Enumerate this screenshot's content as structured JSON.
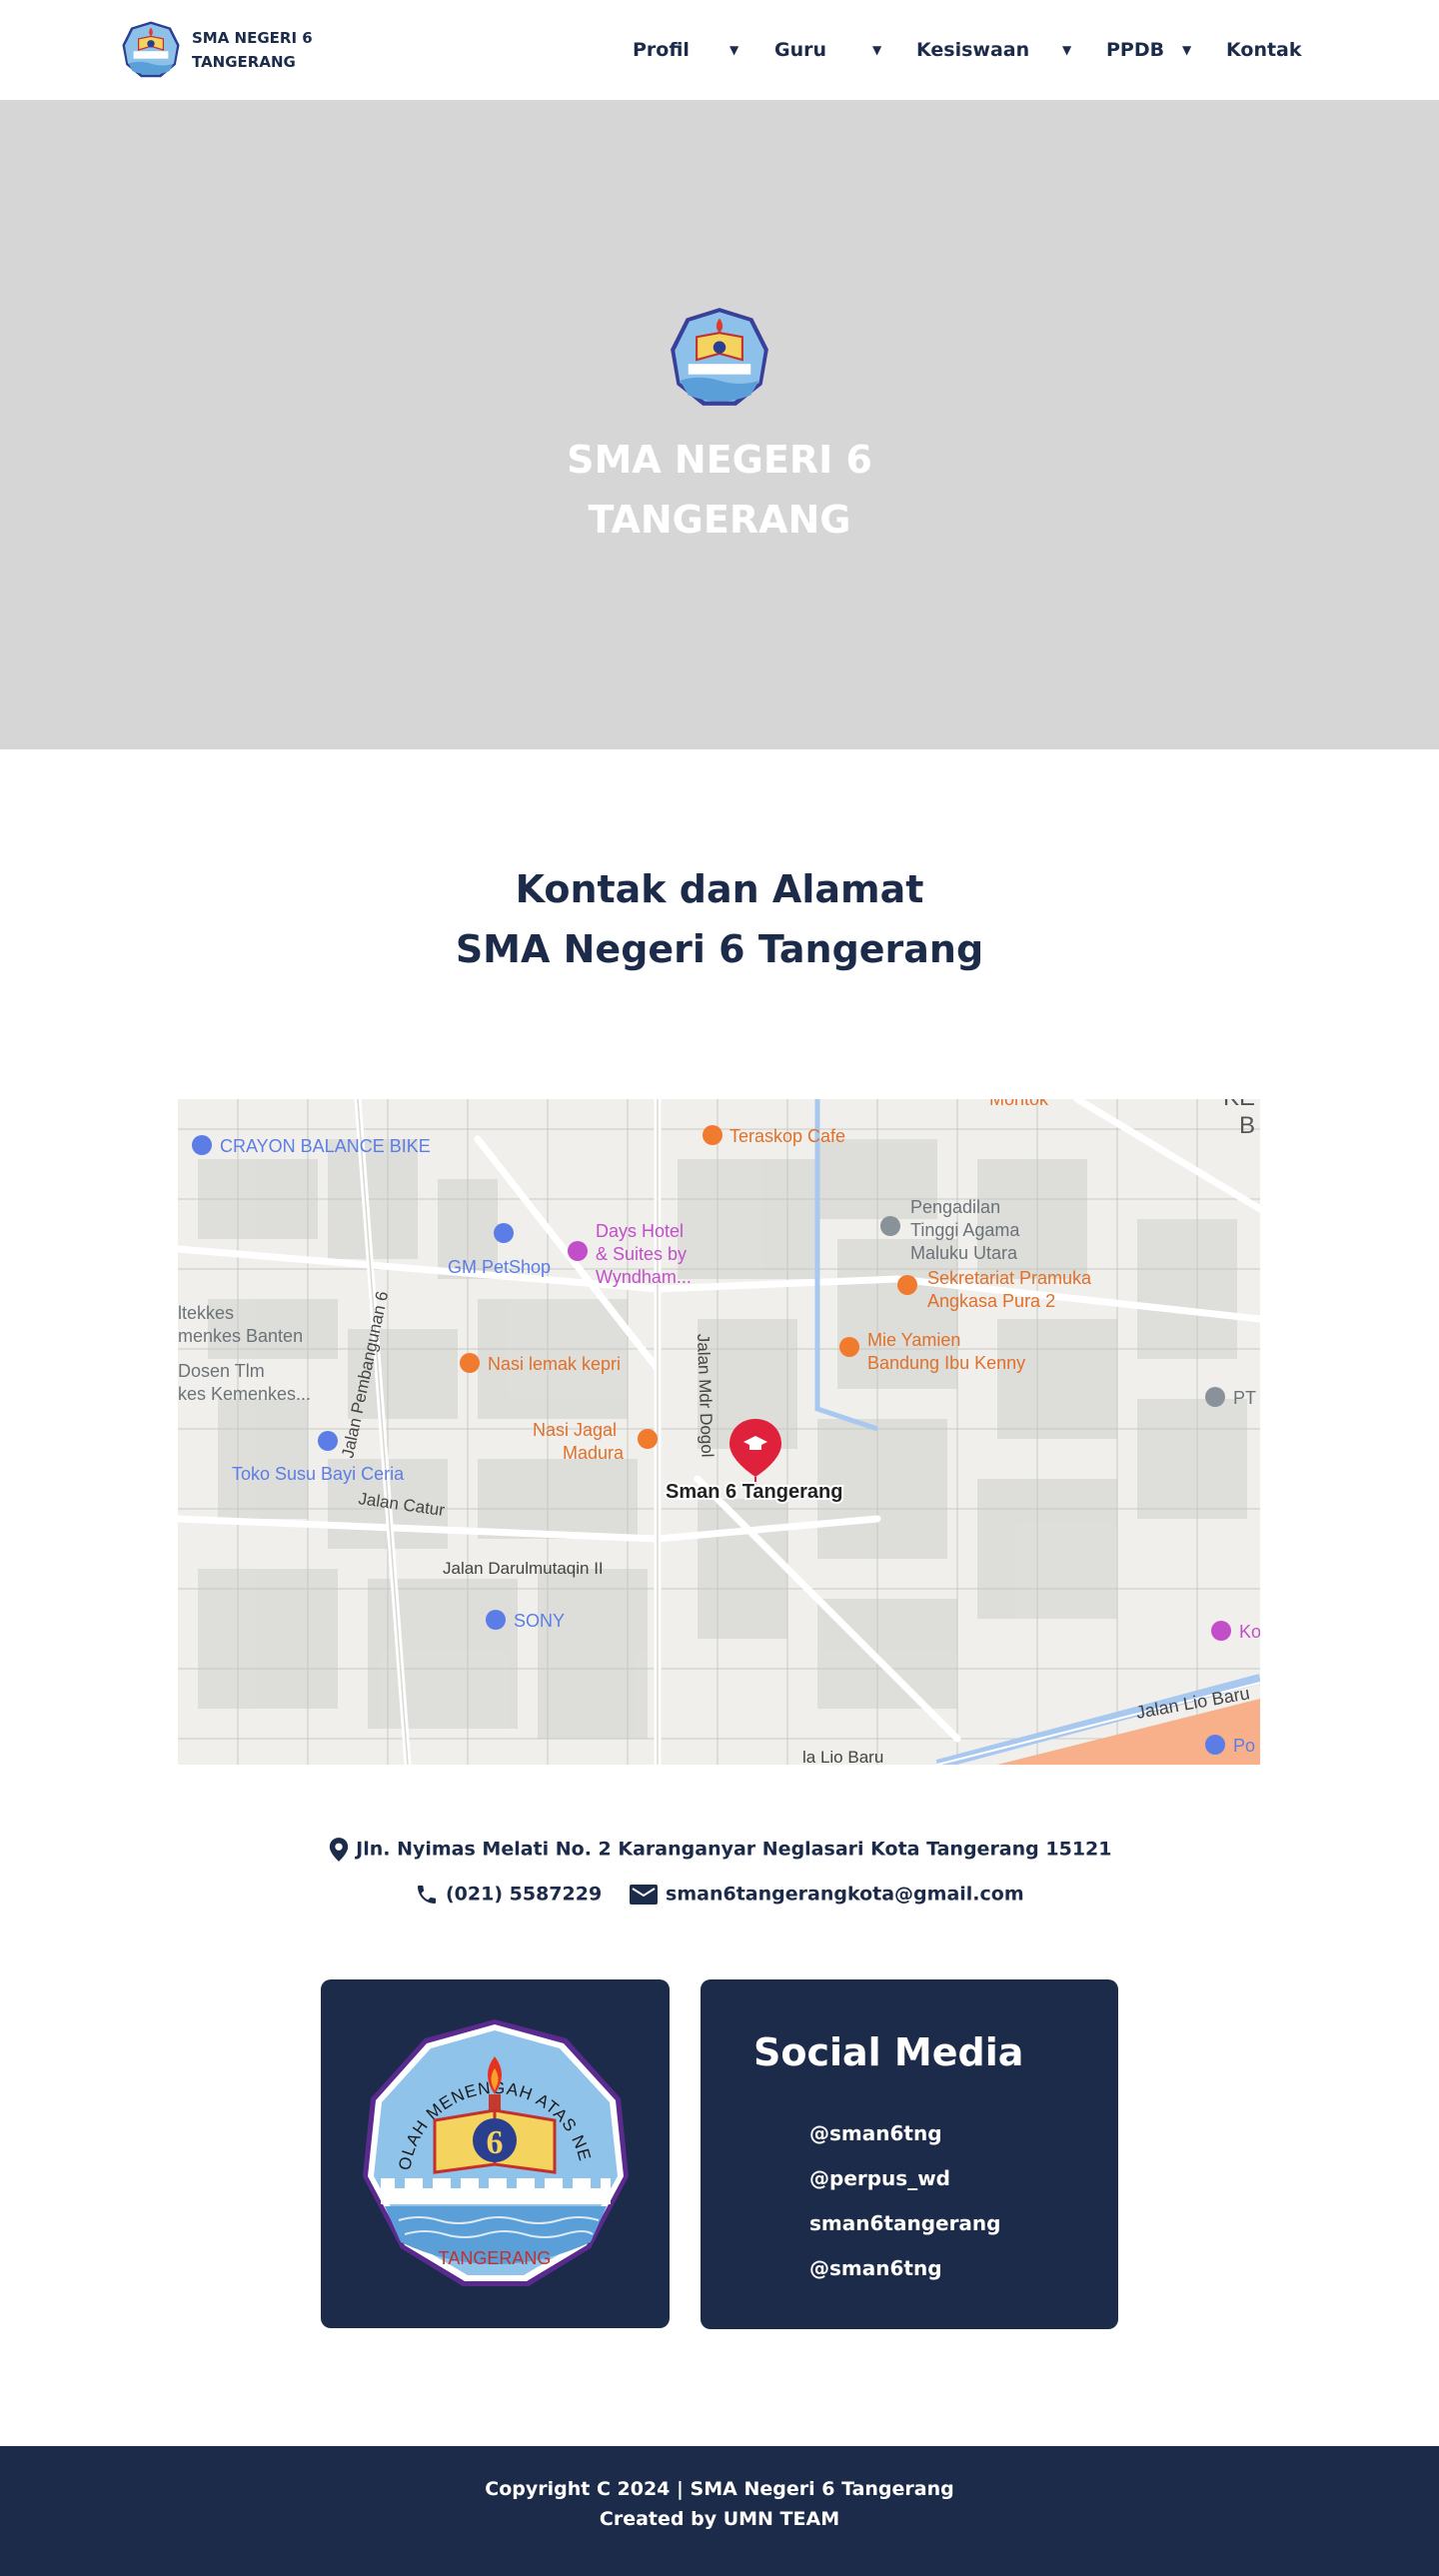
{
  "navbar": {
    "brand_line1": "SMA NEGERI 6",
    "brand_line2": "TANGERANG",
    "items": [
      {
        "label": "Profil",
        "has_dropdown": true
      },
      {
        "label": "Guru",
        "has_dropdown": true
      },
      {
        "label": "Kesiswaan",
        "has_dropdown": true
      },
      {
        "label": "PPDB",
        "has_dropdown": true
      },
      {
        "label": "Kontak",
        "has_dropdown": false
      }
    ],
    "caret": "▼"
  },
  "hero": {
    "title_line1": "SMA NEGERI 6",
    "title_line2": "TANGERANG",
    "background": "#d6d6d6"
  },
  "contact": {
    "title_line1": "Kontak dan Alamat",
    "title_line2": "SMA Negeri 6 Tangerang",
    "address": "Jln. Nyimas Melati No. 2 Karanganyar Neglasari Kota Tangerang  15121",
    "phone": "(021) 5587229",
    "email": "sman6tangerangkota@gmail.com",
    "icons": {
      "address": "location-pin-icon",
      "phone": "phone-icon",
      "email": "mail-icon"
    }
  },
  "map": {
    "pin_label": "Sman 6 Tangerang",
    "places": {
      "crayon": "CRAYON BALANCE BIKE",
      "teraskop": "Teraskop Cafe",
      "montok": "Montok",
      "pengadilan_1": "Pengadilan",
      "pengadilan_2": "Tinggi Agama",
      "pengadilan_3": "Maluku Utara",
      "days_1": "Days Hotel",
      "days_2": "& Suites by",
      "days_3": "Wyndham...",
      "petshop": "GM PetShop",
      "pramuka_1": "Sekretariat Pramuka",
      "pramuka_2": "Angkasa Pura 2",
      "itekkes_1": "ltekkes",
      "itekkes_2": "menkes Banten",
      "dosen_1": "Dosen Tlm",
      "dosen_2": "kes Kemenkes...",
      "nasilemak": "Nasi lemak kepri",
      "mieyamien_1": "Mie Yamien",
      "mieyamien_2": "Bandung Ibu Kenny",
      "pt": "PT",
      "nasijagal_1": "Nasi Jagal",
      "nasijagal_2": "Madura",
      "tokosusu": "Toko Susu Bayi Ceria",
      "sony": "SONY",
      "ko": "Ko",
      "po": "Po",
      "b_right": "B",
      "ke_right": "KE"
    },
    "roads": {
      "pembangunan": "Jalan Pembangunan 6",
      "mdrdogol": "Jalan Mdr Dogol",
      "catur": "Jalan Catur",
      "darul": "Jalan Darulmutaqin II",
      "liobaru": "Jalan Lio Baru",
      "liobaru2": "la Lio Baru"
    },
    "colors": {
      "pin": "#e0213b",
      "food": "#f07b2e",
      "shop": "#5c7de6",
      "hotel": "#c24fc9",
      "gov": "#8a9299",
      "river": "#a8c8f0",
      "road": "#ffffff"
    }
  },
  "logo_card": {
    "arc_text": "SEKOLAH MENENGAH ATAS NEGERI",
    "bottom_text": "TANGERANG",
    "number": "6"
  },
  "social": {
    "title": "Social Media",
    "items": [
      "@sman6tng",
      "@perpus_wd",
      "sman6tangerang",
      "@sman6tng"
    ]
  },
  "footer": {
    "line1": "Copyright C 2024 | SMA Negeri 6 Tangerang",
    "line2": "Created by UMN TEAM",
    "background": "#1c2b4a"
  }
}
